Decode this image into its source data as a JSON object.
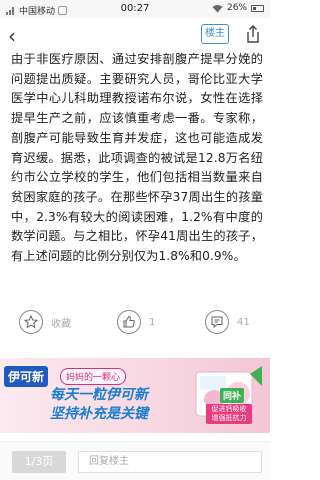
{
  "status_bar": {
    "carrier": "中国移动",
    "time": "00:27",
    "battery": "26%"
  },
  "nav": {
    "back": "‹",
    "louzhu": "楼主"
  },
  "article": {
    "text": "由于非医疗原因、通过安排剖腹产提早分娩的问题提出质疑。主要研究人员，哥伦比亚大学医学中心儿科助理教授诺布尔说，女性在选择提早生产之前，应该慎重考虑一番。专家称，剖腹产可能导致生育并发症，这也可能造成发育迟缓。据悉，此项调查的被试是12.8万名纽约市公立学校的学生，他们包括相当数量来自贫困家庭的孩子。在那些怀孕37周出生的孩童中，2.3%有较大的阅读困难，1.2%有中度的数学问题。与之相比，怀孕41周出生的孩子，有上述问题的比例分别仅为1.8%和0.9%。"
  },
  "actions": {
    "favorite_label": "收藏",
    "like_count": "1",
    "comment_count": "41"
  },
  "ad": {
    "brand": "伊可新",
    "slogan_small": "妈妈的一颗心",
    "line1": "每天一粒伊可新",
    "line2": "坚持补充是关键",
    "product_label": "同补",
    "product_tag": "促进钙吸收 增强抵抗力"
  },
  "bottom": {
    "page": "1/3页",
    "reply_placeholder": "回复楼主"
  },
  "colors": {
    "accent": "#3a8fd9",
    "ad_blue": "#1b7fd1",
    "ad_pink": "#d2337a"
  }
}
